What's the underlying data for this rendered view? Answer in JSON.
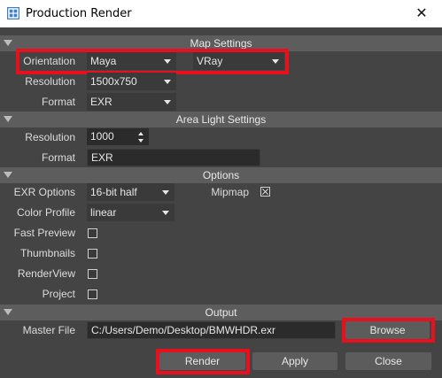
{
  "window": {
    "title": "Production Render",
    "close_glyph": "✕",
    "icon": "app-icon"
  },
  "map_settings": {
    "header": "Map Settings",
    "orientation_label": "Orientation",
    "orientation_value": "Maya",
    "renderer_value": "VRay",
    "resolution_label": "Resolution",
    "resolution_value": "1500x750",
    "format_label": "Format",
    "format_value": "EXR"
  },
  "area_light": {
    "header": "Area Light Settings",
    "resolution_label": "Resolution",
    "resolution_value": "1000",
    "format_label": "Format",
    "format_value": "EXR"
  },
  "options": {
    "header": "Options",
    "exr_options_label": "EXR Options",
    "exr_options_value": "16-bit half",
    "mipmap_label": "Mipmap",
    "mipmap_checked": true,
    "color_profile_label": "Color Profile",
    "color_profile_value": "linear",
    "fast_preview_label": "Fast Preview",
    "fast_preview_checked": false,
    "thumbnails_label": "Thumbnails",
    "thumbnails_checked": false,
    "renderview_label": "RenderView",
    "renderview_checked": false,
    "project_label": "Project",
    "project_checked": false
  },
  "output": {
    "header": "Output",
    "master_file_label": "Master File",
    "master_file_value": "C:/Users/Demo/Desktop/BMWHDR.exr",
    "browse_label": "Browse"
  },
  "actions": {
    "render_label": "Render",
    "apply_label": "Apply",
    "close_label": "Close"
  },
  "colors": {
    "highlight": "#e8101d",
    "background": "#444444",
    "header_bg": "#5d5d5d"
  }
}
